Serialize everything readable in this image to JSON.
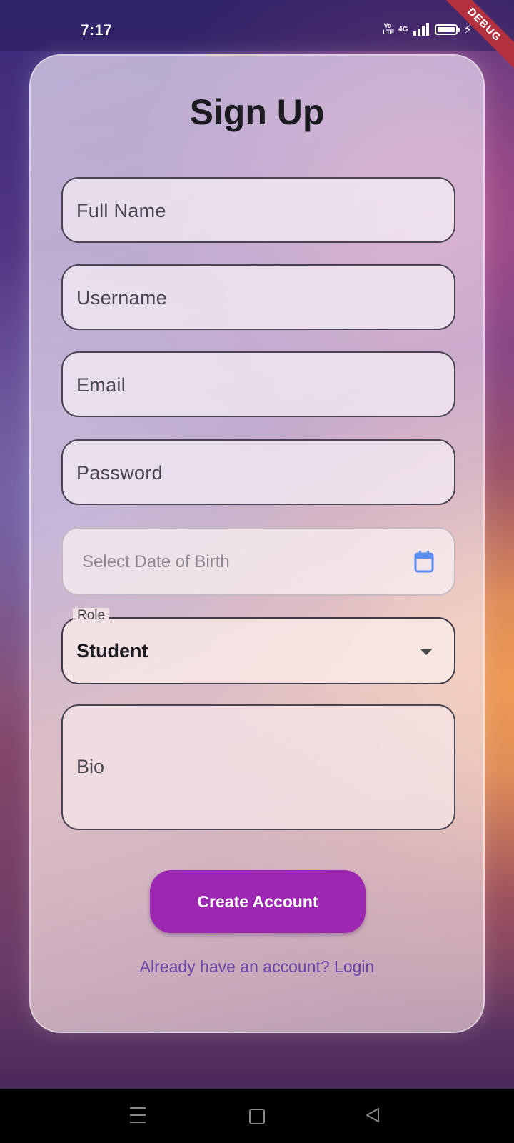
{
  "status_bar": {
    "time": "7:17",
    "volte": "Vo LTE",
    "network": "4G",
    "icons": [
      "volte-icon",
      "signal-icon",
      "battery-icon",
      "charging-icon"
    ]
  },
  "debug_banner": "DEBUG",
  "form": {
    "title": "Sign Up",
    "full_name_placeholder": "Full Name",
    "username_placeholder": "Username",
    "email_placeholder": "Email",
    "password_placeholder": "Password",
    "dob_placeholder": "Select Date of Birth",
    "role_label": "Role",
    "role_value": "Student",
    "bio_placeholder": "Bio",
    "submit_label": "Create Account",
    "login_link": "Already have an account? Login"
  },
  "colors": {
    "accent": "#9c27b0",
    "link": "#6a45a8",
    "calendar_icon": "#5b8def",
    "debug_banner": "#b3303f"
  },
  "nav_bar": {
    "icons": [
      "menu-icon",
      "home-icon",
      "back-icon"
    ]
  }
}
